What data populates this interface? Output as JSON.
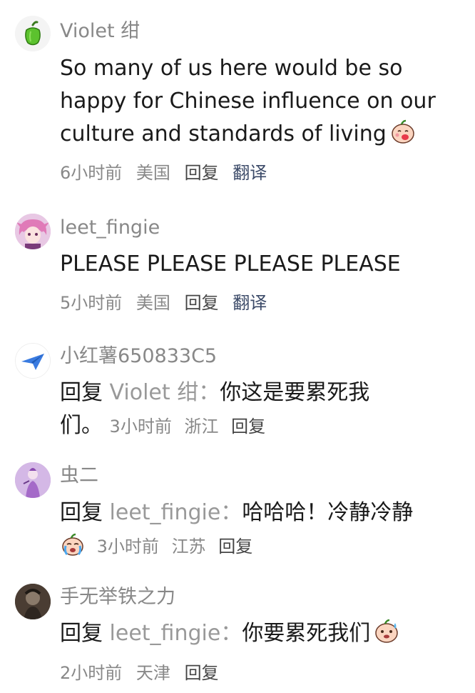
{
  "comments": [
    {
      "username": "Violet 绀",
      "avatar_icon": "green-pepper-avatar-icon",
      "lines": [
        "So many of us here would be so",
        "happy for Chinese influence on our",
        "culture and standards of living"
      ],
      "emoji": "laughing-peach-emoji",
      "time": "6小时前",
      "location": "美国",
      "reply_label": "回复",
      "translate_label": "翻译"
    },
    {
      "username": "leet_fingie",
      "avatar_icon": "anime-girl-avatar-icon",
      "lines": [
        "PLEASE PLEASE PLEASE PLEASE"
      ],
      "time": "5小时前",
      "location": "美国",
      "reply_label": "回复",
      "translate_label": "翻译"
    },
    {
      "username": "小红薯650833C5",
      "avatar_icon": "paper-plane-avatar-icon",
      "reply_prefix": "回复",
      "reply_target": "Violet 绀：",
      "text_line1": "你这是要累死我",
      "text_line2": "们。",
      "time": "3小时前",
      "location": "浙江",
      "reply_label": "回复"
    },
    {
      "username": "虫二",
      "avatar_icon": "purple-figure-avatar-icon",
      "reply_prefix": "回复",
      "reply_target": "leet_fingie：",
      "text_line1": "哈哈哈！冷静冷静",
      "emoji": "crying-peach-emoji",
      "time": "3小时前",
      "location": "江苏",
      "reply_label": "回复"
    },
    {
      "username": "手无举铁之力",
      "avatar_icon": "dark-character-avatar-icon",
      "reply_prefix": "回复",
      "reply_target": "leet_fingie：",
      "text_line1": "你要累死我们",
      "emoji": "sweating-peach-emoji",
      "time": "2小时前",
      "location": "天津",
      "reply_label": "回复"
    }
  ]
}
